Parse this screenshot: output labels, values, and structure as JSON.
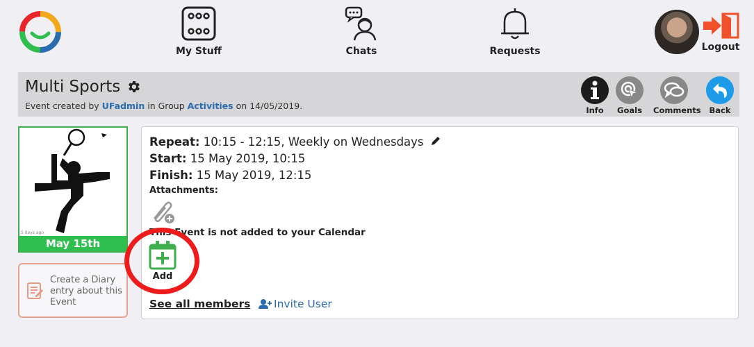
{
  "nav": {
    "my_stuff": "My Stuff",
    "chats": "Chats",
    "requests": "Requests",
    "logout": "Logout"
  },
  "event": {
    "title": "Multi Sports",
    "created_prefix": "Event created by ",
    "creator": "UFadmin",
    "group_prefix": " in Group ",
    "group": "Activities",
    "date_prefix": " on ",
    "created_date": "14/05/2019."
  },
  "header_buttons": {
    "info": "Info",
    "goals": "Goals",
    "comments": "Comments",
    "back": "Back"
  },
  "card": {
    "days_ago": "5 days ago",
    "date": "May 15th"
  },
  "diary": {
    "text": "Create a Diary entry about this Event"
  },
  "details": {
    "repeat_label": "Repeat:",
    "repeat_value": " 10:15 - 12:15, Weekly on Wednesdays",
    "start_label": "Start:",
    "start_value": " 15 May 2019, 10:15",
    "finish_label": "Finish:",
    "finish_value": " 15 May 2019, 12:15",
    "attachments_label": "Attachments:",
    "calendar_message": "This Event is not added to your Calendar",
    "add_label": "Add",
    "see_all_members": "See all members",
    "invite_user": "Invite User"
  },
  "colors": {
    "accent_blue": "#2b6cb0",
    "green": "#2fbf4f",
    "logout_orange": "#f0502a",
    "annotation_red": "#ee1b1b"
  }
}
